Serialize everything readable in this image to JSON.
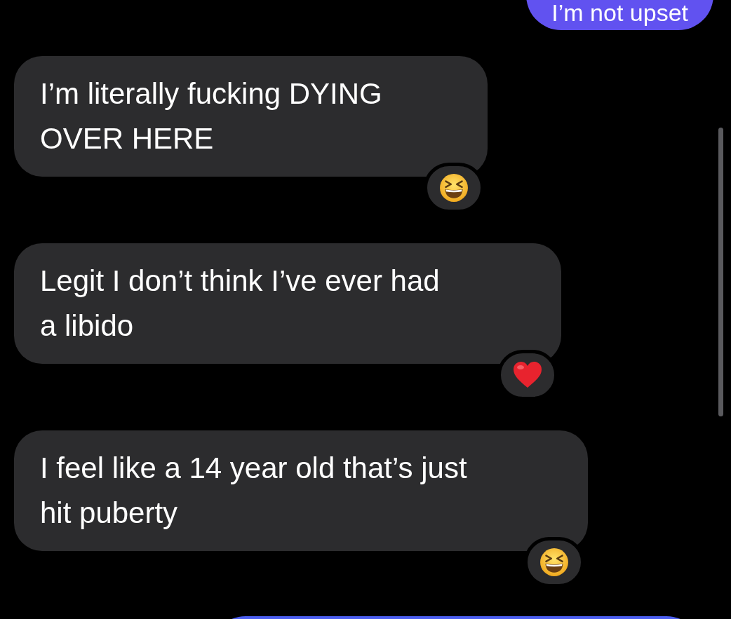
{
  "messages": [
    {
      "kind": "sent",
      "text": "I’m not upset"
    },
    {
      "kind": "received",
      "text": "I’m literally fucking DYING OVER HERE",
      "reaction": {
        "kind": "laugh"
      }
    },
    {
      "kind": "received",
      "text": "Legit I don’t think I’ve ever had a libido",
      "reaction": {
        "kind": "heart"
      }
    },
    {
      "kind": "received",
      "text": "I feel like a 14 year old that’s just hit puberty",
      "reaction": {
        "kind": "laugh"
      }
    },
    {
      "kind": "sent"
    }
  ]
}
